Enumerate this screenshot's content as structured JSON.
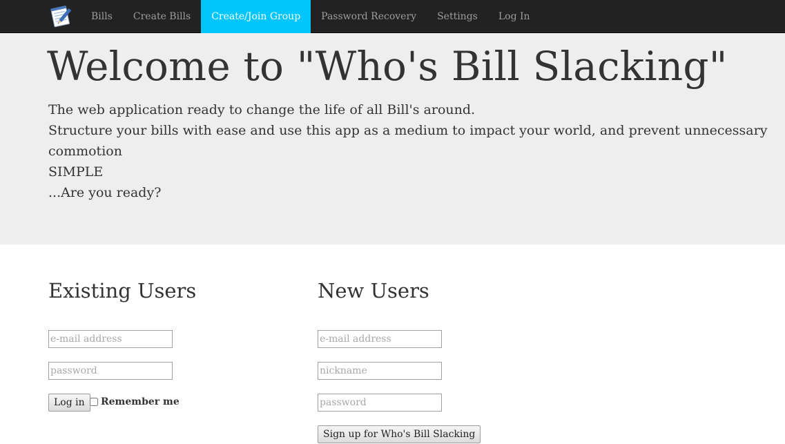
{
  "navbar": {
    "brand_icon": "notepad-pencil-icon",
    "items": [
      {
        "label": "Bills",
        "active": false
      },
      {
        "label": "Create Bills",
        "active": false
      },
      {
        "label": "Create/Join Group",
        "active": true
      },
      {
        "label": "Password Recovery",
        "active": false
      },
      {
        "label": "Settings",
        "active": false
      },
      {
        "label": "Log In",
        "active": false
      }
    ],
    "active_color": "#00c6ff",
    "background": "#222222"
  },
  "hero": {
    "title": "Welcome to \"Who's Bill Slacking\"",
    "lines": [
      "The web application ready to change the life of all Bill's around.",
      "Structure your bills with ease and use this app as a medium to impact your world, and prevent unnecessary commotion",
      "SIMPLE",
      "...Are you ready?"
    ]
  },
  "existing_users": {
    "title": "Existing Users",
    "email_placeholder": "e-mail address",
    "password_placeholder": "password",
    "login_label": "Log in",
    "remember_label": "Remember me"
  },
  "new_users": {
    "title": "New Users",
    "email_placeholder": "e-mail address",
    "nickname_placeholder": "nickname",
    "password_placeholder": "password",
    "signup_label": "Sign up for Who's Bill Slacking"
  }
}
